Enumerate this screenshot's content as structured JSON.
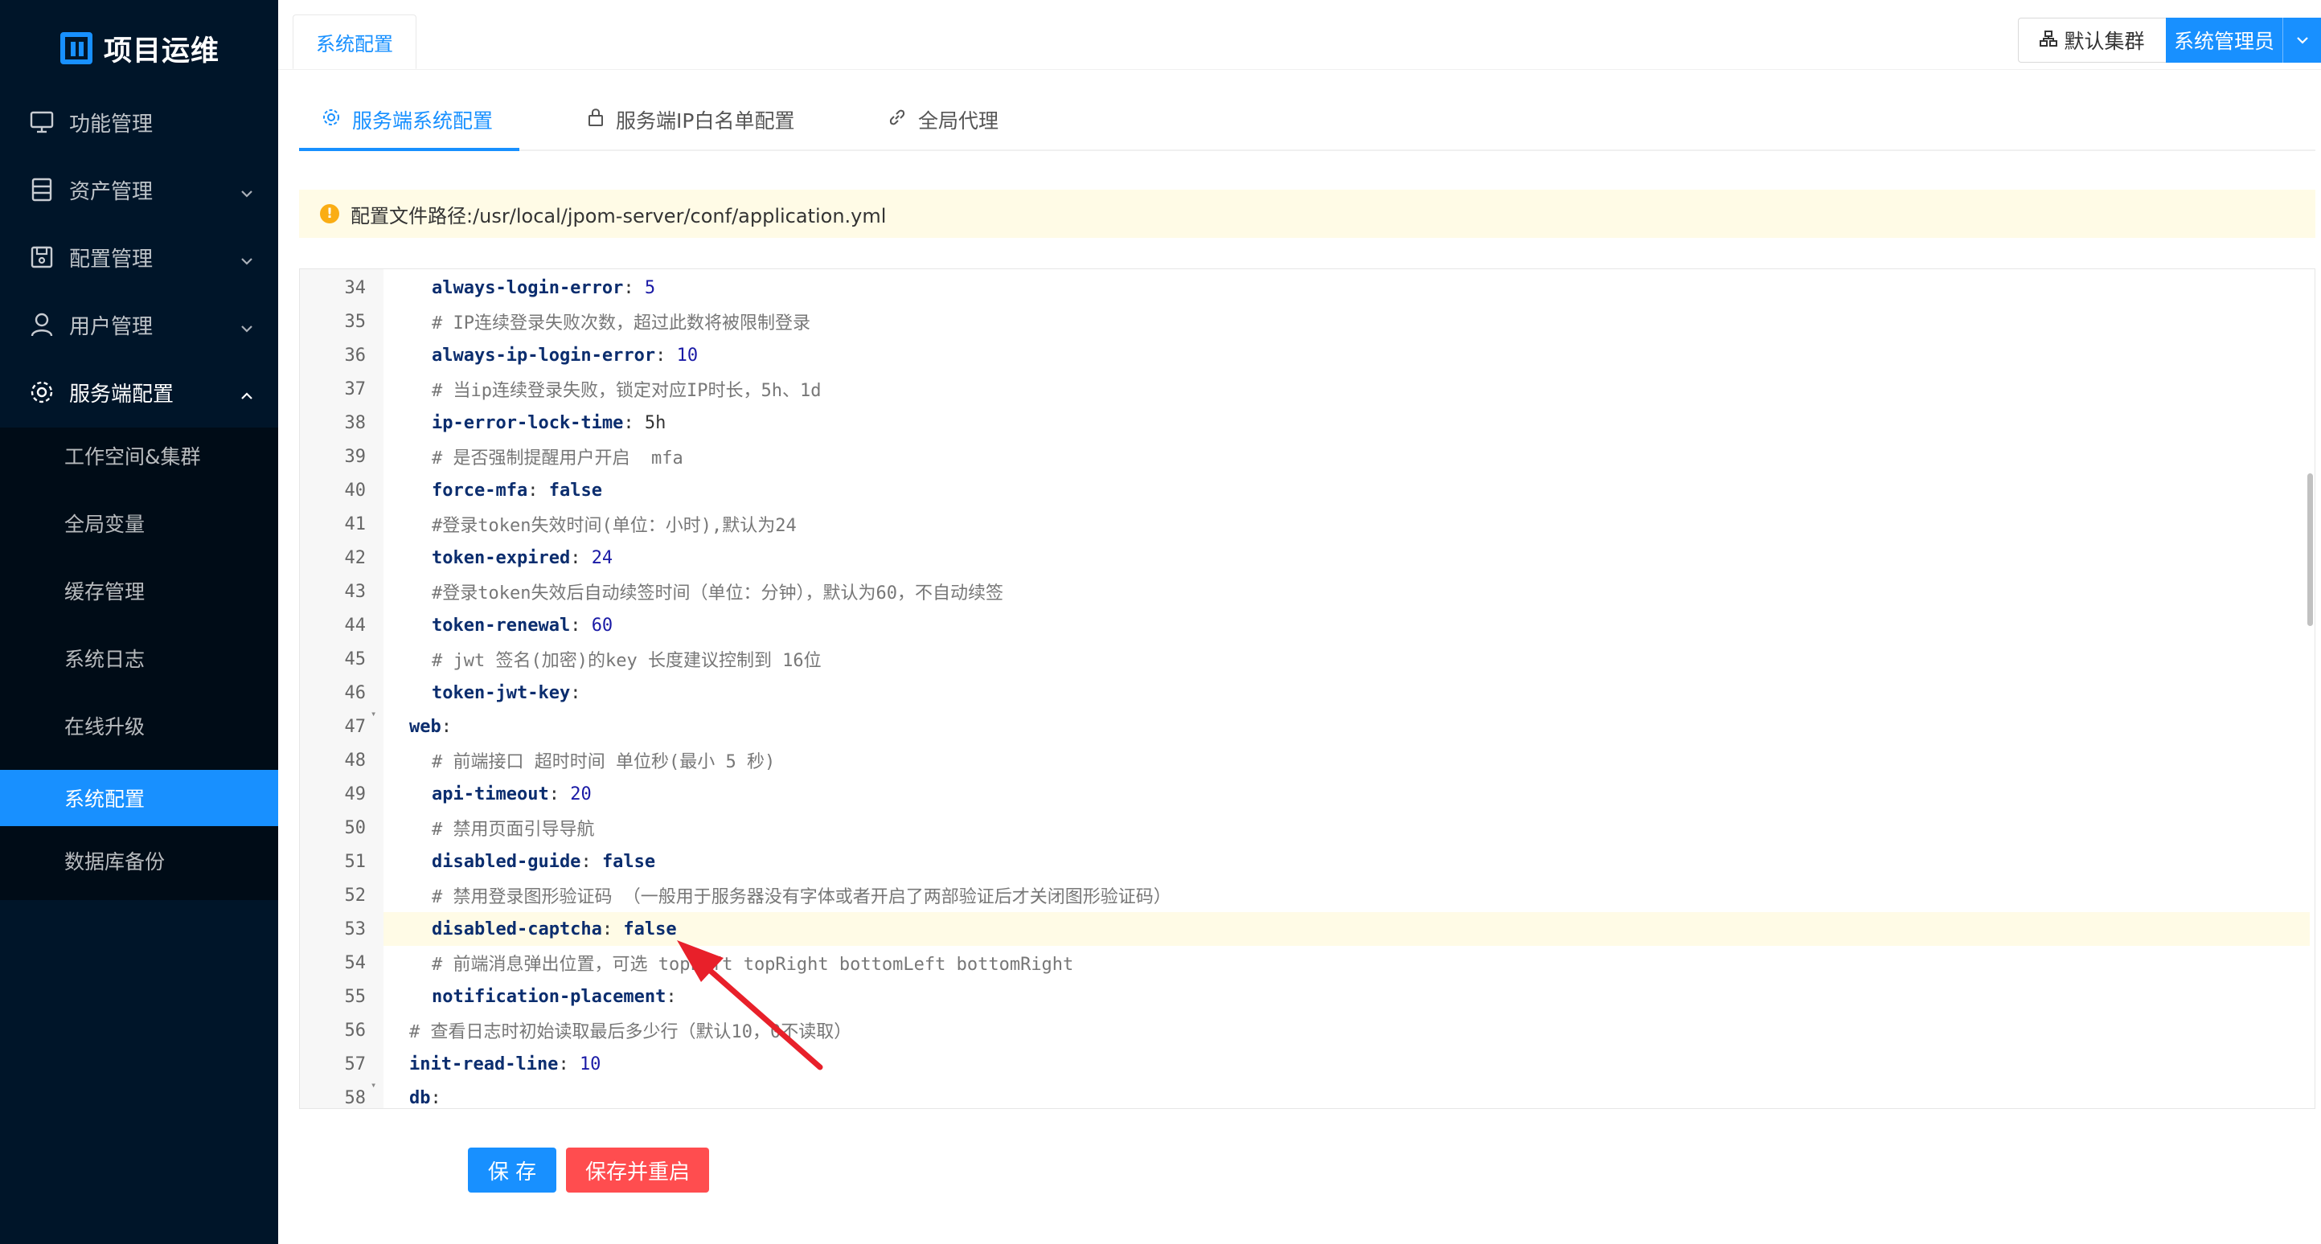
{
  "app": {
    "title": "项目运维"
  },
  "sidebar": {
    "items": [
      {
        "label": "功能管理",
        "icon": "monitor-icon"
      },
      {
        "label": "资产管理",
        "icon": "server-icon"
      },
      {
        "label": "配置管理",
        "icon": "save-icon"
      },
      {
        "label": "用户管理",
        "icon": "user-icon"
      },
      {
        "label": "服务端配置",
        "icon": "gear-icon"
      }
    ],
    "submenu": [
      {
        "label": "工作空间&集群"
      },
      {
        "label": "全局变量"
      },
      {
        "label": "缓存管理"
      },
      {
        "label": "系统日志"
      },
      {
        "label": "在线升级"
      },
      {
        "label": "系统配置",
        "active": true
      },
      {
        "label": "数据库备份"
      }
    ]
  },
  "topbar": {
    "page_tab": "系统配置",
    "cluster": "默认集群",
    "user": "系统管理员"
  },
  "settings_tabs": [
    {
      "label": "服务端系统配置",
      "icon": "gear-icon",
      "active": true
    },
    {
      "label": "服务端IP白名单配置",
      "icon": "lock-icon"
    },
    {
      "label": "全局代理",
      "icon": "link-icon"
    }
  ],
  "alert": {
    "text": "配置文件路径:/usr/local/jpom-server/conf/application.yml"
  },
  "editor": {
    "highlight_line": 53,
    "lines": [
      {
        "n": "34",
        "indent": "  ",
        "key": "always-login-error",
        "sep": ": ",
        "val": "5",
        "kind": "num"
      },
      {
        "n": "35",
        "indent": "  ",
        "comment": "# IP连续登录失败次数，超过此数将被限制登录"
      },
      {
        "n": "36",
        "indent": "  ",
        "key": "always-ip-login-error",
        "sep": ": ",
        "val": "10",
        "kind": "num"
      },
      {
        "n": "37",
        "indent": "  ",
        "comment": "# 当ip连续登录失败，锁定对应IP时长，5h、1d"
      },
      {
        "n": "38",
        "indent": "  ",
        "key": "ip-error-lock-time",
        "sep": ": ",
        "val": "5h",
        "kind": "str"
      },
      {
        "n": "39",
        "indent": "  ",
        "comment": "# 是否强制提醒用户开启  mfa"
      },
      {
        "n": "40",
        "indent": "  ",
        "key": "force-mfa",
        "sep": ": ",
        "val": "false",
        "kind": "bool"
      },
      {
        "n": "41",
        "indent": "  ",
        "comment": "#登录token失效时间(单位：小时),默认为24"
      },
      {
        "n": "42",
        "indent": "  ",
        "key": "token-expired",
        "sep": ": ",
        "val": "24",
        "kind": "num"
      },
      {
        "n": "43",
        "indent": "  ",
        "comment": "#登录token失效后自动续签时间（单位：分钟），默认为60，不自动续签"
      },
      {
        "n": "44",
        "indent": "  ",
        "key": "token-renewal",
        "sep": ": ",
        "val": "60",
        "kind": "num"
      },
      {
        "n": "45",
        "indent": "  ",
        "comment": "# jwt 签名(加密)的key 长度建议控制到 16位"
      },
      {
        "n": "46",
        "indent": "  ",
        "key": "token-jwt-key",
        "sep": ":",
        "val": "",
        "kind": "str"
      },
      {
        "n": "47",
        "indent": "",
        "key": "web",
        "sep": ":",
        "val": "",
        "kind": "str",
        "fold": true
      },
      {
        "n": "48",
        "indent": "  ",
        "comment": "# 前端接口 超时时间 单位秒(最小 5 秒)"
      },
      {
        "n": "49",
        "indent": "  ",
        "key": "api-timeout",
        "sep": ": ",
        "val": "20",
        "kind": "num"
      },
      {
        "n": "50",
        "indent": "  ",
        "comment": "# 禁用页面引导导航"
      },
      {
        "n": "51",
        "indent": "  ",
        "key": "disabled-guide",
        "sep": ": ",
        "val": "false",
        "kind": "bool"
      },
      {
        "n": "52",
        "indent": "  ",
        "comment": "# 禁用登录图形验证码 （一般用于服务器没有字体或者开启了两部验证后才关闭图形验证码）"
      },
      {
        "n": "53",
        "indent": "  ",
        "key": "disabled-captcha",
        "sep": ": ",
        "val": "false",
        "kind": "bool"
      },
      {
        "n": "54",
        "indent": "  ",
        "comment": "# 前端消息弹出位置，可选 topLeft topRight bottomLeft bottomRight"
      },
      {
        "n": "55",
        "indent": "  ",
        "key": "notification-placement",
        "sep": ":",
        "val": "",
        "kind": "str"
      },
      {
        "n": "56",
        "indent": "",
        "comment": "# 查看日志时初始读取最后多少行（默认10，0不读取）"
      },
      {
        "n": "57",
        "indent": "",
        "key": "init-read-line",
        "sep": ": ",
        "val": "10",
        "kind": "num"
      },
      {
        "n": "58",
        "indent": "",
        "key": "db",
        "sep": ":",
        "val": "",
        "kind": "str",
        "fold": true
      }
    ]
  },
  "actions": {
    "save": "保 存",
    "save_restart": "保存并重启"
  },
  "colors": {
    "accent": "#1890ff",
    "danger": "#ff4d4f",
    "sidebar": "#001529",
    "annotation": "#e8202a"
  }
}
